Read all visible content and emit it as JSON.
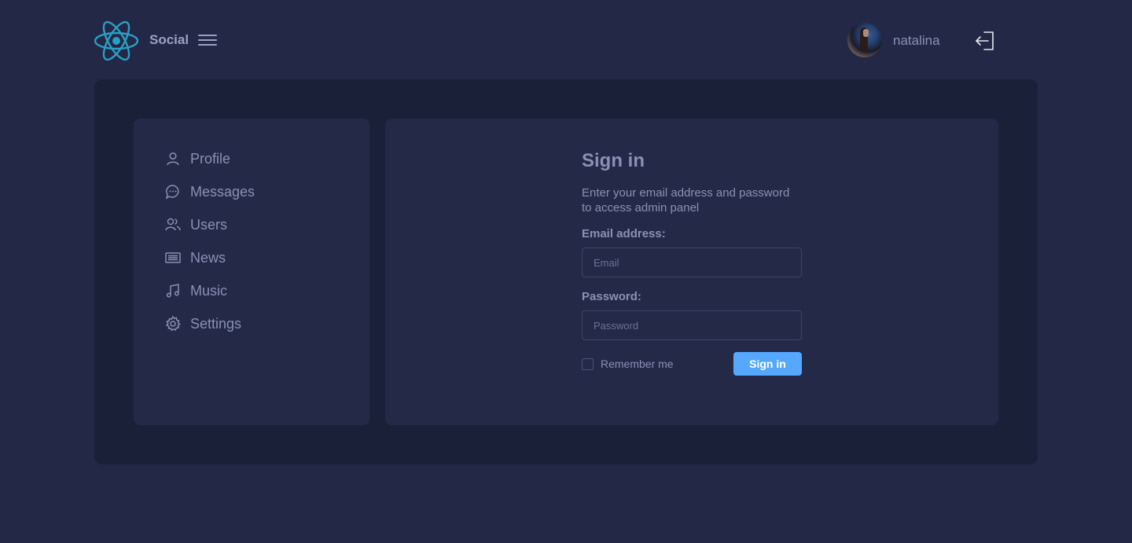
{
  "header": {
    "brand": "Social",
    "username": "natalina"
  },
  "sidebar": {
    "items": [
      {
        "label": "Profile",
        "icon": "user-icon"
      },
      {
        "label": "Messages",
        "icon": "message-icon"
      },
      {
        "label": "Users",
        "icon": "users-icon"
      },
      {
        "label": "News",
        "icon": "news-icon"
      },
      {
        "label": "Music",
        "icon": "music-icon"
      },
      {
        "label": "Settings",
        "icon": "gear-icon"
      }
    ]
  },
  "signin": {
    "title": "Sign in",
    "subtitle_line1": "Enter your email address and password",
    "subtitle_line2": "to access admin panel",
    "email_label": "Email address:",
    "email_placeholder": "Email",
    "password_label": "Password:",
    "password_placeholder": "Password",
    "remember_label": "Remember me",
    "button_label": "Sign in"
  },
  "colors": {
    "background": "#222845",
    "panel": "#232946",
    "outer_panel": "#1b2039",
    "text": "#8a90b4",
    "accent": "#56a8ff",
    "logo": "#2a9fc4"
  }
}
